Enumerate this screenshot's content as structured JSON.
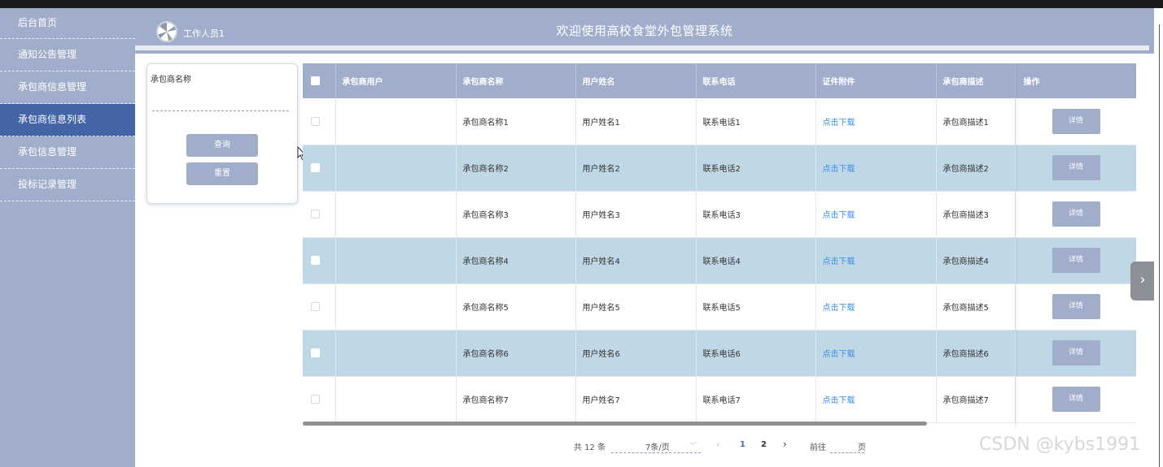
{
  "header": {
    "title": "欢迎使用高校食堂外包管理系统",
    "username": "工作人员1"
  },
  "sidebar": {
    "items": [
      {
        "label": "后台首页"
      },
      {
        "label": "通知公告管理"
      },
      {
        "label": "承包商信息管理"
      },
      {
        "label": "承包商信息列表"
      },
      {
        "label": "承包信息管理"
      },
      {
        "label": "投标记录管理"
      }
    ],
    "active_index": 3
  },
  "search": {
    "label": "承包商名称",
    "value": "",
    "query_label": "查询",
    "reset_label": "重置"
  },
  "table": {
    "columns": [
      "承包商用户",
      "承包商名称",
      "用户姓名",
      "联系电话",
      "证件附件",
      "承包商描述",
      "操作"
    ],
    "rows": [
      {
        "user": "",
        "name": "承包商名称1",
        "real_name": "用户姓名1",
        "phone": "联系电话1",
        "attachment": "点击下载",
        "desc": "承包商描述1",
        "action": "详情"
      },
      {
        "user": "",
        "name": "承包商名称2",
        "real_name": "用户姓名2",
        "phone": "联系电话2",
        "attachment": "点击下载",
        "desc": "承包商描述2",
        "action": "详情"
      },
      {
        "user": "",
        "name": "承包商名称3",
        "real_name": "用户姓名3",
        "phone": "联系电话3",
        "attachment": "点击下载",
        "desc": "承包商描述3",
        "action": "详情"
      },
      {
        "user": "",
        "name": "承包商名称4",
        "real_name": "用户姓名4",
        "phone": "联系电话4",
        "attachment": "点击下载",
        "desc": "承包商描述4",
        "action": "详情"
      },
      {
        "user": "",
        "name": "承包商名称5",
        "real_name": "用户姓名5",
        "phone": "联系电话5",
        "attachment": "点击下载",
        "desc": "承包商描述5",
        "action": "详情"
      },
      {
        "user": "",
        "name": "承包商名称6",
        "real_name": "用户姓名6",
        "phone": "联系电话6",
        "attachment": "点击下载",
        "desc": "承包商描述6",
        "action": "详情"
      },
      {
        "user": "",
        "name": "承包商名称7",
        "real_name": "用户姓名7",
        "phone": "联系电话7",
        "attachment": "点击下载",
        "desc": "承包商描述7",
        "action": "详情"
      }
    ]
  },
  "pagination": {
    "total": "共 12 条",
    "page_size": "7条/页",
    "pages": [
      "1",
      "2"
    ],
    "current_page": "1",
    "goto_label": "前往",
    "goto_value": "",
    "page_suffix": "页"
  },
  "watermark": "CSDN @kybs1991",
  "colors": {
    "sidebar_bg": "#a0aecb",
    "active_bg": "#4464a8",
    "alt_row": "#c0d7e6",
    "link": "#3d8ee8"
  }
}
